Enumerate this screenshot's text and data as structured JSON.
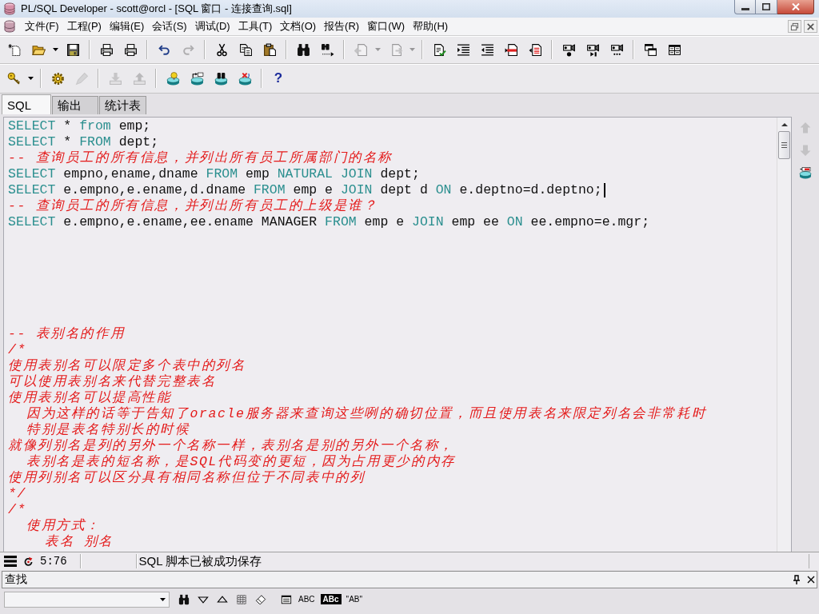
{
  "window": {
    "title": "PL/SQL Developer - scott@orcl - [SQL 窗口 - 连接查询.sql]"
  },
  "menu_bar": [
    "文件(F)",
    "工程(P)",
    "编辑(E)",
    "会话(S)",
    "调试(D)",
    "工具(T)",
    "文档(O)",
    "报告(R)",
    "窗口(W)",
    "帮助(H)"
  ],
  "toolbar_1": [
    {
      "kind": "button",
      "disabled": false
    },
    {
      "kind": "button",
      "disabled": false
    },
    {
      "kind": "arrow",
      "disabled": false
    },
    {
      "kind": "button",
      "disabled": false
    },
    {
      "kind": "separator"
    },
    {
      "kind": "button",
      "disabled": false
    },
    {
      "kind": "button",
      "disabled": false
    },
    {
      "kind": "separator"
    },
    {
      "kind": "button",
      "disabled": false
    },
    {
      "kind": "button",
      "disabled": true
    },
    {
      "kind": "separator"
    },
    {
      "kind": "button",
      "disabled": false
    },
    {
      "kind": "button",
      "disabled": false
    },
    {
      "kind": "button",
      "disabled": false
    },
    {
      "kind": "separator"
    },
    {
      "kind": "button",
      "disabled": false
    },
    {
      "kind": "button",
      "disabled": false
    },
    {
      "kind": "separator"
    },
    {
      "kind": "button",
      "disabled": true
    },
    {
      "kind": "arrow",
      "disabled": true
    },
    {
      "kind": "button",
      "disabled": true
    },
    {
      "kind": "arrow",
      "disabled": true
    },
    {
      "kind": "separator"
    },
    {
      "kind": "button",
      "disabled": false
    },
    {
      "kind": "button",
      "disabled": false
    },
    {
      "kind": "button",
      "disabled": false
    },
    {
      "kind": "button",
      "disabled": false
    },
    {
      "kind": "button",
      "disabled": false
    },
    {
      "kind": "separator"
    },
    {
      "kind": "button",
      "disabled": false
    },
    {
      "kind": "button",
      "disabled": false
    },
    {
      "kind": "button",
      "disabled": false
    },
    {
      "kind": "separator"
    },
    {
      "kind": "button",
      "disabled": false
    },
    {
      "kind": "button",
      "disabled": false
    }
  ],
  "toolbar_2": [
    {
      "kind": "button",
      "disabled": false
    },
    {
      "kind": "arrow",
      "disabled": false
    },
    {
      "kind": "separator"
    },
    {
      "kind": "button",
      "disabled": false
    },
    {
      "kind": "button",
      "disabled": true
    },
    {
      "kind": "separator"
    },
    {
      "kind": "button",
      "disabled": true
    },
    {
      "kind": "button",
      "disabled": true
    },
    {
      "kind": "separator"
    },
    {
      "kind": "button",
      "disabled": false
    },
    {
      "kind": "button",
      "disabled": false
    },
    {
      "kind": "button",
      "disabled": false
    },
    {
      "kind": "button",
      "disabled": false
    },
    {
      "kind": "separator"
    },
    {
      "kind": "text",
      "label": "?",
      "disabled": false
    }
  ],
  "tabs": [
    {
      "label": "SQL",
      "selected": true
    },
    {
      "label": "输出",
      "selected": false
    },
    {
      "label": "统计表",
      "selected": false
    }
  ],
  "editor": {
    "lines": [
      {
        "tokens": [
          {
            "kind": "keyword",
            "text": "SELECT"
          },
          {
            "kind": "plain",
            "text": " * "
          },
          {
            "kind": "keyword",
            "text": "from"
          },
          {
            "kind": "plain",
            "text": " emp;"
          }
        ],
        "caret": false
      },
      {
        "tokens": [
          {
            "kind": "keyword",
            "text": "SELECT"
          },
          {
            "kind": "plain",
            "text": " * "
          },
          {
            "kind": "keyword",
            "text": "FROM"
          },
          {
            "kind": "plain",
            "text": " dept;"
          }
        ],
        "caret": false
      },
      {
        "tokens": [
          {
            "kind": "comment",
            "text": "-- 查询员工的所有信息，并列出所有员工所属部门的名称"
          }
        ],
        "caret": false
      },
      {
        "tokens": [
          {
            "kind": "keyword",
            "text": "SELECT"
          },
          {
            "kind": "plain",
            "text": " empno,ename,dname "
          },
          {
            "kind": "keyword",
            "text": "FROM"
          },
          {
            "kind": "plain",
            "text": " emp "
          },
          {
            "kind": "keyword",
            "text": "NATURAL JOIN"
          },
          {
            "kind": "plain",
            "text": " dept;"
          }
        ],
        "caret": false
      },
      {
        "tokens": [
          {
            "kind": "keyword",
            "text": "SELECT"
          },
          {
            "kind": "plain",
            "text": " e.empno,e.ename,d.dname "
          },
          {
            "kind": "keyword",
            "text": "FROM"
          },
          {
            "kind": "plain",
            "text": " emp e "
          },
          {
            "kind": "keyword",
            "text": "JOIN"
          },
          {
            "kind": "plain",
            "text": " dept d "
          },
          {
            "kind": "keyword",
            "text": "ON"
          },
          {
            "kind": "plain",
            "text": " e.deptno=d.deptno;"
          }
        ],
        "caret": true
      },
      {
        "tokens": [
          {
            "kind": "comment",
            "text": "-- 查询员工的所有信息，并列出所有员工的上级是谁？"
          }
        ],
        "caret": false
      },
      {
        "tokens": [
          {
            "kind": "keyword",
            "text": "SELECT"
          },
          {
            "kind": "plain",
            "text": " e.empno,e.ename,ee.ename MANAGER "
          },
          {
            "kind": "keyword",
            "text": "FROM"
          },
          {
            "kind": "plain",
            "text": " emp e "
          },
          {
            "kind": "keyword",
            "text": "JOIN"
          },
          {
            "kind": "plain",
            "text": " emp ee "
          },
          {
            "kind": "keyword",
            "text": "ON"
          },
          {
            "kind": "plain",
            "text": " ee.empno=e.mgr;"
          }
        ],
        "caret": false
      },
      {
        "caret": false
      },
      {
        "caret": false
      },
      {
        "caret": false
      },
      {
        "caret": false
      },
      {
        "caret": false
      },
      {
        "caret": false
      },
      {
        "tokens": [
          {
            "kind": "comment",
            "text": "-- 表别名的作用"
          }
        ],
        "caret": false
      },
      {
        "tokens": [
          {
            "kind": "comment",
            "text": "/*"
          }
        ],
        "caret": false
      },
      {
        "tokens": [
          {
            "kind": "comment",
            "text": "使用表别名可以限定多个表中的列名"
          }
        ],
        "caret": false
      },
      {
        "tokens": [
          {
            "kind": "comment",
            "text": "可以使用表别名来代替完整表名"
          }
        ],
        "caret": false
      },
      {
        "tokens": [
          {
            "kind": "comment",
            "text": "使用表别名可以提高性能"
          }
        ],
        "caret": false
      },
      {
        "tokens": [
          {
            "kind": "comment",
            "text": "  因为这样的话等于告知了oracle服务器来查询这些咧的确切位置，而且使用表名来限定列名会非常耗时"
          }
        ],
        "caret": false
      },
      {
        "tokens": [
          {
            "kind": "comment",
            "text": "  特别是表名特别长的时候"
          }
        ],
        "caret": false
      },
      {
        "tokens": [
          {
            "kind": "comment",
            "text": "就像列别名是列的另外一个名称一样，表别名是别的另外一个名称，"
          }
        ],
        "caret": false
      },
      {
        "tokens": [
          {
            "kind": "comment",
            "text": "  表别名是表的短名称，是SQL代码变的更短，因为占用更少的内存"
          }
        ],
        "caret": false
      },
      {
        "tokens": [
          {
            "kind": "comment",
            "text": "使用列别名可以区分具有相同名称但位于不同表中的列"
          }
        ],
        "caret": false
      },
      {
        "tokens": [
          {
            "kind": "comment",
            "text": "*/"
          }
        ],
        "caret": false
      },
      {
        "tokens": [
          {
            "kind": "comment",
            "text": "/*"
          }
        ],
        "caret": false
      },
      {
        "tokens": [
          {
            "kind": "comment",
            "text": "  使用方式："
          }
        ],
        "caret": false
      },
      {
        "tokens": [
          {
            "kind": "comment",
            "text": "    表名 别名"
          }
        ],
        "caret": false
      }
    ],
    "side_buttons": [
      {
        "disabled": true
      },
      {
        "disabled": true
      },
      {
        "disabled": false
      }
    ]
  },
  "status_bar": {
    "position": "5:76",
    "message": "SQL 脚本已被成功保存"
  },
  "find_panel": {
    "title": "查找",
    "toolbar": [
      {
        "kind": "button"
      },
      {
        "kind": "button"
      },
      {
        "kind": "button"
      },
      {
        "kind": "button"
      },
      {
        "kind": "button"
      },
      {
        "kind": "button"
      },
      {
        "kind": "text",
        "label": "ABC"
      },
      {
        "kind": "inverted",
        "label": "ABc"
      },
      {
        "kind": "text",
        "label": "\"AB\""
      }
    ]
  }
}
